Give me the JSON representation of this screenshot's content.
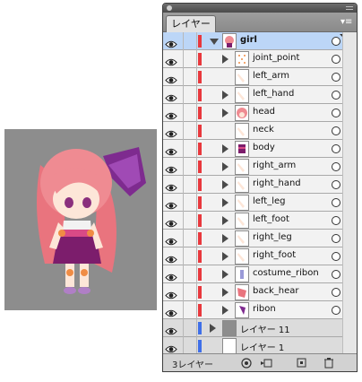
{
  "panel": {
    "tab_label": "レイヤー",
    "menu_icon": "panel-menu-icon",
    "status": "3レイヤー"
  },
  "layers": [
    {
      "name": "girl",
      "level": 0,
      "expanded": true,
      "has_arrow": true,
      "selected": true,
      "bold": true,
      "thumb": "girl"
    },
    {
      "name": "joint_point",
      "level": 1,
      "has_arrow": true,
      "thumb": "dots"
    },
    {
      "name": "left_arm",
      "level": 1,
      "has_arrow": false,
      "thumb": "skin"
    },
    {
      "name": "left_hand",
      "level": 1,
      "has_arrow": true,
      "thumb": "skin"
    },
    {
      "name": "head",
      "level": 1,
      "has_arrow": true,
      "thumb": "head"
    },
    {
      "name": "neck",
      "level": 1,
      "has_arrow": false,
      "thumb": "skin"
    },
    {
      "name": "body",
      "level": 1,
      "has_arrow": true,
      "thumb": "body"
    },
    {
      "name": "right_arm",
      "level": 1,
      "has_arrow": true,
      "thumb": "skin"
    },
    {
      "name": "right_hand",
      "level": 1,
      "has_arrow": true,
      "thumb": "skin"
    },
    {
      "name": "left_leg",
      "level": 1,
      "has_arrow": true,
      "thumb": "skin"
    },
    {
      "name": "left_foot",
      "level": 1,
      "has_arrow": true,
      "thumb": "skin"
    },
    {
      "name": "right_leg",
      "level": 1,
      "has_arrow": true,
      "thumb": "skin"
    },
    {
      "name": "right_foot",
      "level": 1,
      "has_arrow": true,
      "thumb": "skin"
    },
    {
      "name": "costume_ribon",
      "level": 1,
      "has_arrow": true,
      "thumb": "ribbon"
    },
    {
      "name": "back_hear",
      "level": 1,
      "has_arrow": true,
      "thumb": "hair"
    },
    {
      "name": "ribon",
      "level": 1,
      "has_arrow": true,
      "thumb": "ribbon2"
    },
    {
      "name": "レイヤー 11",
      "level": 0,
      "has_arrow": true,
      "other": true,
      "thumb": "gray",
      "color": "#3f6fe8"
    },
    {
      "name": "レイヤー 1",
      "level": 0,
      "has_arrow": false,
      "other": true,
      "thumb": "white",
      "color": "#3f6fe8"
    }
  ],
  "colors": {
    "layer_color_girl": "#e8383d",
    "layer_color_blue": "#3f6fe8",
    "selected_row": "#bcd6f7"
  },
  "status_buttons": [
    "make-clipping-mask-icon",
    "create-sublayer-icon",
    "create-layer-icon",
    "delete-icon"
  ]
}
